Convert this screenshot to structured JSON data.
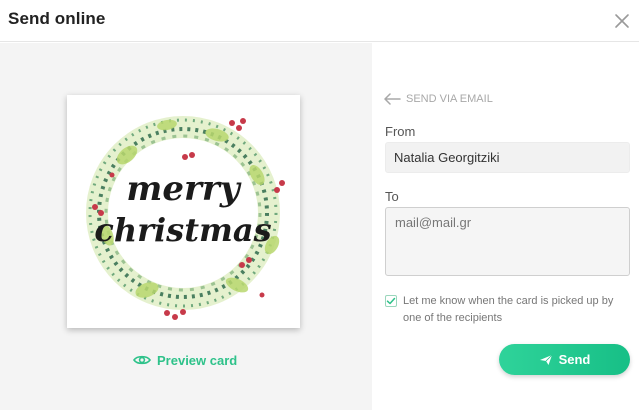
{
  "dialog": {
    "title": "Send online",
    "close_icon": "close-icon"
  },
  "preview": {
    "card_alt": "Merry Christmas watercolor wreath card",
    "card_text_line1": "merry",
    "card_text_line2": "christmas",
    "preview_label": "Preview card",
    "preview_icon": "eye-icon"
  },
  "form": {
    "back_label": "SEND VIA EMAIL",
    "back_icon": "arrow-left-icon",
    "from_label": "From",
    "from_value": "Natalia Georgitziki",
    "to_label": "To",
    "to_placeholder": "mail@mail.gr",
    "notify_checked": true,
    "notify_label": "Let me know when the card is picked up by one of the recipients",
    "send_label": "Send",
    "send_icon": "paper-plane-icon"
  },
  "colors": {
    "accent": "#2ec28a",
    "panel_bg": "#f4f4f4"
  }
}
